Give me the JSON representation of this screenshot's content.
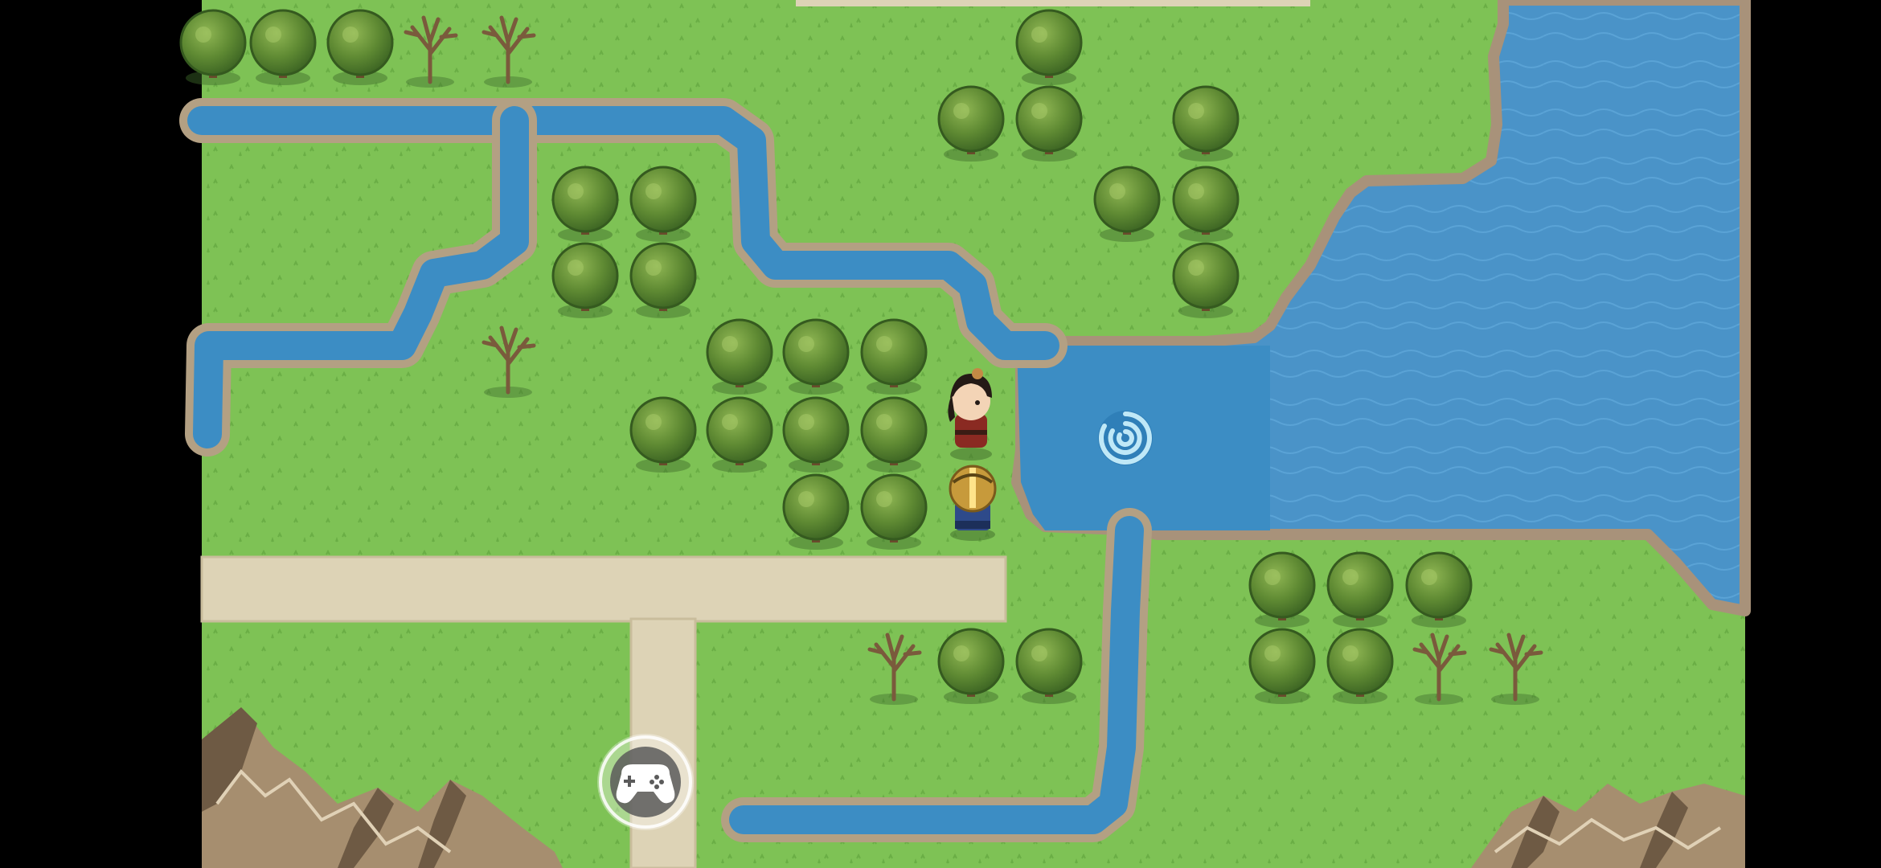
{
  "app": {
    "orientation": "landscape"
  },
  "colors": {
    "letterbox": "#000000",
    "grass": "#7ec255",
    "grass_dark": "#6db046",
    "water": "#3c8dc4",
    "water_deep": "#2f7fb8",
    "lake": "#4a93c8",
    "bank_rock": "#b7a184",
    "path": "#ddd3b6",
    "tree_canopy": "#5f8a33",
    "tree_canopy_dark": "#3f6a26",
    "tree_trunk": "#6b4a2c",
    "mountain": "#a68e6f",
    "mountain_shadow": "#6e5a44",
    "swirl": "#bfe8f7"
  },
  "scene": {
    "player": {
      "sprite": "hero-character",
      "facing": "down"
    },
    "companion": {
      "sprite": "armored-knight",
      "facing": "up"
    },
    "portal": {
      "type": "water-whirlpool"
    }
  },
  "controls": {
    "virtual_gamepad": {
      "icon": "gamepad-icon"
    }
  }
}
